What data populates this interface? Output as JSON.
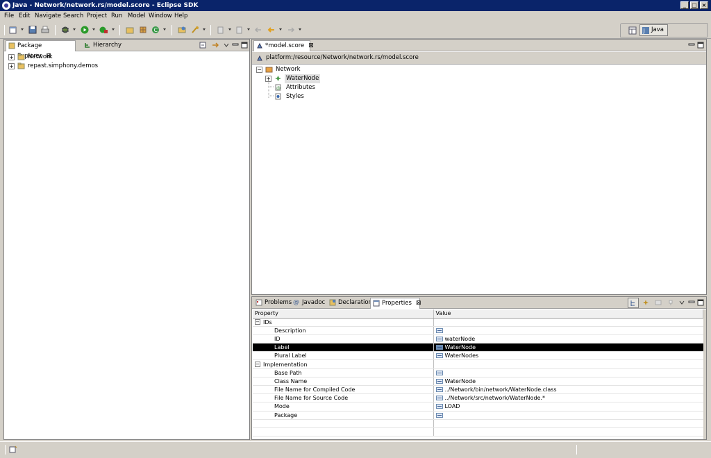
{
  "window": {
    "title": "Java - Network/network.rs/model.score - Eclipse SDK",
    "controls": [
      "_",
      "□",
      "×"
    ]
  },
  "menu": [
    "File",
    "Edit",
    "Navigate",
    "Search",
    "Project",
    "Run",
    "Model",
    "Window",
    "Help"
  ],
  "perspective": {
    "label": "Java"
  },
  "package_explorer": {
    "tabs": [
      {
        "label": "Package Explorer",
        "active": true
      },
      {
        "label": "Hierarchy",
        "active": false
      }
    ],
    "close": "⊠",
    "items": [
      {
        "label": "Network",
        "icon": "project-icon"
      },
      {
        "label": "repast.simphony.demos",
        "icon": "project-icon"
      }
    ]
  },
  "editor": {
    "tab_label": "*model.score",
    "close": "⊠",
    "breadcrumb": "platform:/resource/Network/network.rs/model.score",
    "tree": {
      "root": "Network",
      "children": [
        {
          "label": "WaterNode",
          "selected": true,
          "expandable": true
        },
        {
          "label": "Attributes",
          "selected": false,
          "expandable": false
        },
        {
          "label": "Styles",
          "selected": false,
          "expandable": false
        }
      ]
    }
  },
  "bottom_panel": {
    "tabs": [
      {
        "label": "Problems",
        "active": false,
        "icon": "problems-icon"
      },
      {
        "label": "Javadoc",
        "active": false,
        "icon": "at-icon"
      },
      {
        "label": "Declaration",
        "active": false,
        "icon": "declaration-icon"
      },
      {
        "label": "Properties",
        "active": true,
        "icon": "properties-icon"
      }
    ],
    "close": "⊠",
    "columns": [
      "Property",
      "Value"
    ],
    "groups": [
      {
        "name": "IDs",
        "rows": [
          {
            "property": "Description",
            "value": ""
          },
          {
            "property": "ID",
            "value": "waterNode"
          },
          {
            "property": "Label",
            "value": "WaterNode",
            "selected": true
          },
          {
            "property": "Plural Label",
            "value": "WaterNodes"
          }
        ]
      },
      {
        "name": "Implementation",
        "rows": [
          {
            "property": "Base Path",
            "value": ""
          },
          {
            "property": "Class Name",
            "value": "WaterNode"
          },
          {
            "property": "File Name for Compiled Code",
            "value": "../Network/bin/network/WaterNode.class"
          },
          {
            "property": "File Name for Source Code",
            "value": "../Network/src/network/WaterNode.*"
          },
          {
            "property": "Mode",
            "value": "LOAD"
          },
          {
            "property": "Package",
            "value": ""
          }
        ]
      }
    ]
  },
  "colors": {
    "titlebar": "#0a246a",
    "chrome": "#d4d0c8",
    "selection": "#000000"
  }
}
